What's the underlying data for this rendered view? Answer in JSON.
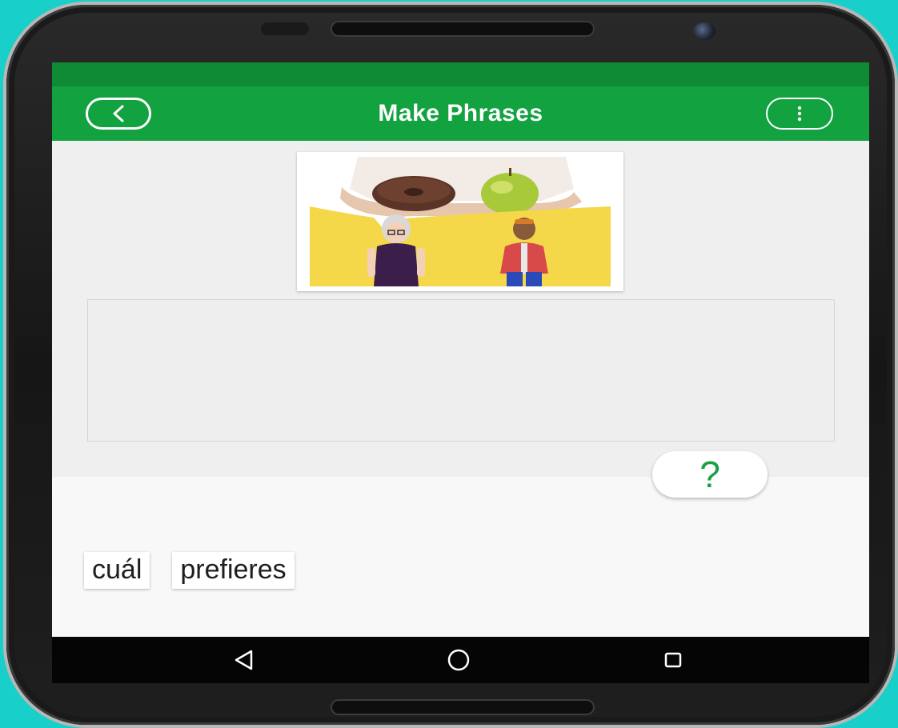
{
  "app_bar": {
    "title": "Make Phrases",
    "back_icon": "chevron-left-circle-icon",
    "menu_icon": "vertical-dots-icon"
  },
  "hint_button": {
    "label": "?"
  },
  "word_tiles": [
    {
      "text": "cuál"
    },
    {
      "text": "prefieres"
    }
  ],
  "colors": {
    "status_bar": "#0f8a35",
    "app_bar": "#12a240",
    "accent": "#1aa042",
    "background": "#19cfc9"
  },
  "nav_bar": {
    "back_icon": "triangle-back-icon",
    "home_icon": "circle-home-icon",
    "recents_icon": "square-recents-icon"
  }
}
